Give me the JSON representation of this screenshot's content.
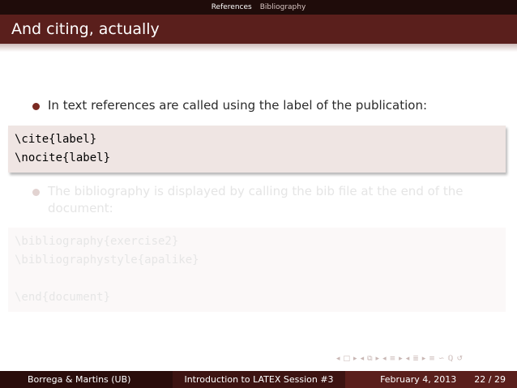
{
  "nav": {
    "tabs": [
      "References",
      "Bibliography"
    ]
  },
  "frame": {
    "title": "And citing, actually"
  },
  "content": {
    "bullet1": "In text references are called using the label of the publication:",
    "code1": [
      "\\cite{label}",
      "\\nocite{label}"
    ],
    "bullet2": "The bibliography is displayed by calling the bib file at the end of the document:",
    "code2": [
      "\\bibliography{exercise2}",
      "\\bibliographystyle{apalike}",
      "",
      "\\end{document}"
    ]
  },
  "footer": {
    "authors": "Borrega & Martins (UB)",
    "title": "Introduction to LATEX Session #3",
    "date": "February 4, 2013",
    "page": "22 / 29"
  },
  "colors": {
    "header_bg": "#5a1f1c",
    "topnav_bg": "#1f0c0a",
    "footer_dark": "#2a0d0b",
    "footer_mid": "#3d1412",
    "code_bg": "#efe5e3",
    "bullet": "#7a2a22"
  },
  "icons": [
    "nav-left-arrow-icon",
    "nav-frame-icon",
    "nav-right-arrow-icon",
    "nav-section-icon",
    "nav-subsection-icon",
    "nav-align-icon",
    "nav-search-icon",
    "nav-back-icon"
  ]
}
